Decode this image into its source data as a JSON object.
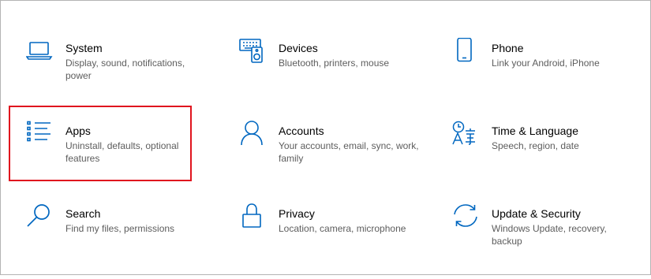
{
  "tiles": [
    {
      "key": "system",
      "title": "System",
      "desc": "Display, sound, notifications, power",
      "icon": "laptop-icon"
    },
    {
      "key": "devices",
      "title": "Devices",
      "desc": "Bluetooth, printers, mouse",
      "icon": "keyboard-speaker-icon"
    },
    {
      "key": "phone",
      "title": "Phone",
      "desc": "Link your Android, iPhone",
      "icon": "phone-icon"
    },
    {
      "key": "apps",
      "title": "Apps",
      "desc": "Uninstall, defaults, optional features",
      "icon": "list-icon"
    },
    {
      "key": "accounts",
      "title": "Accounts",
      "desc": "Your accounts, email, sync, work, family",
      "icon": "person-icon"
    },
    {
      "key": "time-language",
      "title": "Time & Language",
      "desc": "Speech, region, date",
      "icon": "time-language-icon"
    },
    {
      "key": "search",
      "title": "Search",
      "desc": "Find my files, permissions",
      "icon": "search-icon"
    },
    {
      "key": "privacy",
      "title": "Privacy",
      "desc": "Location, camera, microphone",
      "icon": "lock-icon"
    },
    {
      "key": "update-security",
      "title": "Update & Security",
      "desc": "Windows Update, recovery, backup",
      "icon": "sync-icon"
    }
  ],
  "colors": {
    "accent": "#0067c0",
    "highlight": "#e0141e",
    "title": "#000000",
    "description": "#5d5d5d"
  }
}
